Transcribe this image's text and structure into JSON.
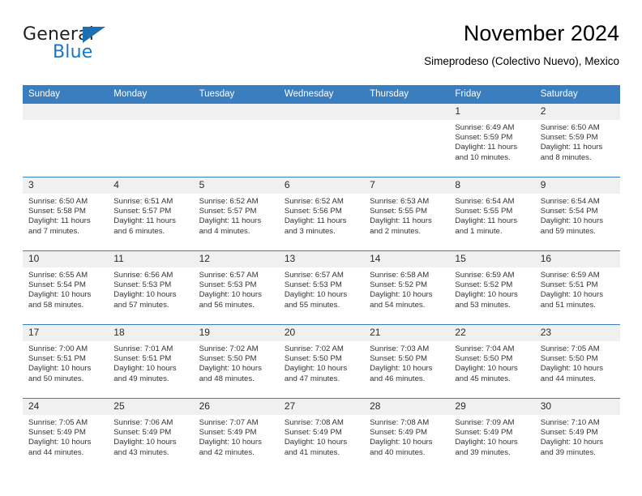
{
  "brand": {
    "name_part1": "General",
    "name_part2": "Blue",
    "accent_color": "#1c77c3",
    "triangle_icon": "triangle-icon"
  },
  "header": {
    "title": "November 2024",
    "subtitle": "Simeprodeso (Colectivo Nuevo), Mexico"
  },
  "calendar": {
    "header_bg": "#3a7ebf",
    "daynum_bg": "#f0f0f0",
    "weekdays": [
      "Sunday",
      "Monday",
      "Tuesday",
      "Wednesday",
      "Thursday",
      "Friday",
      "Saturday"
    ],
    "weeks": [
      [
        {
          "day": "",
          "empty": true
        },
        {
          "day": "",
          "empty": true
        },
        {
          "day": "",
          "empty": true
        },
        {
          "day": "",
          "empty": true
        },
        {
          "day": "",
          "empty": true
        },
        {
          "day": "1",
          "sunrise": "Sunrise: 6:49 AM",
          "sunset": "Sunset: 5:59 PM",
          "daylight_1": "Daylight: 11 hours",
          "daylight_2": "and 10 minutes."
        },
        {
          "day": "2",
          "sunrise": "Sunrise: 6:50 AM",
          "sunset": "Sunset: 5:59 PM",
          "daylight_1": "Daylight: 11 hours",
          "daylight_2": "and 8 minutes."
        }
      ],
      [
        {
          "day": "3",
          "sunrise": "Sunrise: 6:50 AM",
          "sunset": "Sunset: 5:58 PM",
          "daylight_1": "Daylight: 11 hours",
          "daylight_2": "and 7 minutes."
        },
        {
          "day": "4",
          "sunrise": "Sunrise: 6:51 AM",
          "sunset": "Sunset: 5:57 PM",
          "daylight_1": "Daylight: 11 hours",
          "daylight_2": "and 6 minutes."
        },
        {
          "day": "5",
          "sunrise": "Sunrise: 6:52 AM",
          "sunset": "Sunset: 5:57 PM",
          "daylight_1": "Daylight: 11 hours",
          "daylight_2": "and 4 minutes."
        },
        {
          "day": "6",
          "sunrise": "Sunrise: 6:52 AM",
          "sunset": "Sunset: 5:56 PM",
          "daylight_1": "Daylight: 11 hours",
          "daylight_2": "and 3 minutes."
        },
        {
          "day": "7",
          "sunrise": "Sunrise: 6:53 AM",
          "sunset": "Sunset: 5:55 PM",
          "daylight_1": "Daylight: 11 hours",
          "daylight_2": "and 2 minutes."
        },
        {
          "day": "8",
          "sunrise": "Sunrise: 6:54 AM",
          "sunset": "Sunset: 5:55 PM",
          "daylight_1": "Daylight: 11 hours",
          "daylight_2": "and 1 minute."
        },
        {
          "day": "9",
          "sunrise": "Sunrise: 6:54 AM",
          "sunset": "Sunset: 5:54 PM",
          "daylight_1": "Daylight: 10 hours",
          "daylight_2": "and 59 minutes."
        }
      ],
      [
        {
          "day": "10",
          "sunrise": "Sunrise: 6:55 AM",
          "sunset": "Sunset: 5:54 PM",
          "daylight_1": "Daylight: 10 hours",
          "daylight_2": "and 58 minutes."
        },
        {
          "day": "11",
          "sunrise": "Sunrise: 6:56 AM",
          "sunset": "Sunset: 5:53 PM",
          "daylight_1": "Daylight: 10 hours",
          "daylight_2": "and 57 minutes."
        },
        {
          "day": "12",
          "sunrise": "Sunrise: 6:57 AM",
          "sunset": "Sunset: 5:53 PM",
          "daylight_1": "Daylight: 10 hours",
          "daylight_2": "and 56 minutes."
        },
        {
          "day": "13",
          "sunrise": "Sunrise: 6:57 AM",
          "sunset": "Sunset: 5:53 PM",
          "daylight_1": "Daylight: 10 hours",
          "daylight_2": "and 55 minutes."
        },
        {
          "day": "14",
          "sunrise": "Sunrise: 6:58 AM",
          "sunset": "Sunset: 5:52 PM",
          "daylight_1": "Daylight: 10 hours",
          "daylight_2": "and 54 minutes."
        },
        {
          "day": "15",
          "sunrise": "Sunrise: 6:59 AM",
          "sunset": "Sunset: 5:52 PM",
          "daylight_1": "Daylight: 10 hours",
          "daylight_2": "and 53 minutes."
        },
        {
          "day": "16",
          "sunrise": "Sunrise: 6:59 AM",
          "sunset": "Sunset: 5:51 PM",
          "daylight_1": "Daylight: 10 hours",
          "daylight_2": "and 51 minutes."
        }
      ],
      [
        {
          "day": "17",
          "sunrise": "Sunrise: 7:00 AM",
          "sunset": "Sunset: 5:51 PM",
          "daylight_1": "Daylight: 10 hours",
          "daylight_2": "and 50 minutes."
        },
        {
          "day": "18",
          "sunrise": "Sunrise: 7:01 AM",
          "sunset": "Sunset: 5:51 PM",
          "daylight_1": "Daylight: 10 hours",
          "daylight_2": "and 49 minutes."
        },
        {
          "day": "19",
          "sunrise": "Sunrise: 7:02 AM",
          "sunset": "Sunset: 5:50 PM",
          "daylight_1": "Daylight: 10 hours",
          "daylight_2": "and 48 minutes."
        },
        {
          "day": "20",
          "sunrise": "Sunrise: 7:02 AM",
          "sunset": "Sunset: 5:50 PM",
          "daylight_1": "Daylight: 10 hours",
          "daylight_2": "and 47 minutes."
        },
        {
          "day": "21",
          "sunrise": "Sunrise: 7:03 AM",
          "sunset": "Sunset: 5:50 PM",
          "daylight_1": "Daylight: 10 hours",
          "daylight_2": "and 46 minutes."
        },
        {
          "day": "22",
          "sunrise": "Sunrise: 7:04 AM",
          "sunset": "Sunset: 5:50 PM",
          "daylight_1": "Daylight: 10 hours",
          "daylight_2": "and 45 minutes."
        },
        {
          "day": "23",
          "sunrise": "Sunrise: 7:05 AM",
          "sunset": "Sunset: 5:50 PM",
          "daylight_1": "Daylight: 10 hours",
          "daylight_2": "and 44 minutes."
        }
      ],
      [
        {
          "day": "24",
          "sunrise": "Sunrise: 7:05 AM",
          "sunset": "Sunset: 5:49 PM",
          "daylight_1": "Daylight: 10 hours",
          "daylight_2": "and 44 minutes."
        },
        {
          "day": "25",
          "sunrise": "Sunrise: 7:06 AM",
          "sunset": "Sunset: 5:49 PM",
          "daylight_1": "Daylight: 10 hours",
          "daylight_2": "and 43 minutes."
        },
        {
          "day": "26",
          "sunrise": "Sunrise: 7:07 AM",
          "sunset": "Sunset: 5:49 PM",
          "daylight_1": "Daylight: 10 hours",
          "daylight_2": "and 42 minutes."
        },
        {
          "day": "27",
          "sunrise": "Sunrise: 7:08 AM",
          "sunset": "Sunset: 5:49 PM",
          "daylight_1": "Daylight: 10 hours",
          "daylight_2": "and 41 minutes."
        },
        {
          "day": "28",
          "sunrise": "Sunrise: 7:08 AM",
          "sunset": "Sunset: 5:49 PM",
          "daylight_1": "Daylight: 10 hours",
          "daylight_2": "and 40 minutes."
        },
        {
          "day": "29",
          "sunrise": "Sunrise: 7:09 AM",
          "sunset": "Sunset: 5:49 PM",
          "daylight_1": "Daylight: 10 hours",
          "daylight_2": "and 39 minutes."
        },
        {
          "day": "30",
          "sunrise": "Sunrise: 7:10 AM",
          "sunset": "Sunset: 5:49 PM",
          "daylight_1": "Daylight: 10 hours",
          "daylight_2": "and 39 minutes."
        }
      ]
    ]
  }
}
